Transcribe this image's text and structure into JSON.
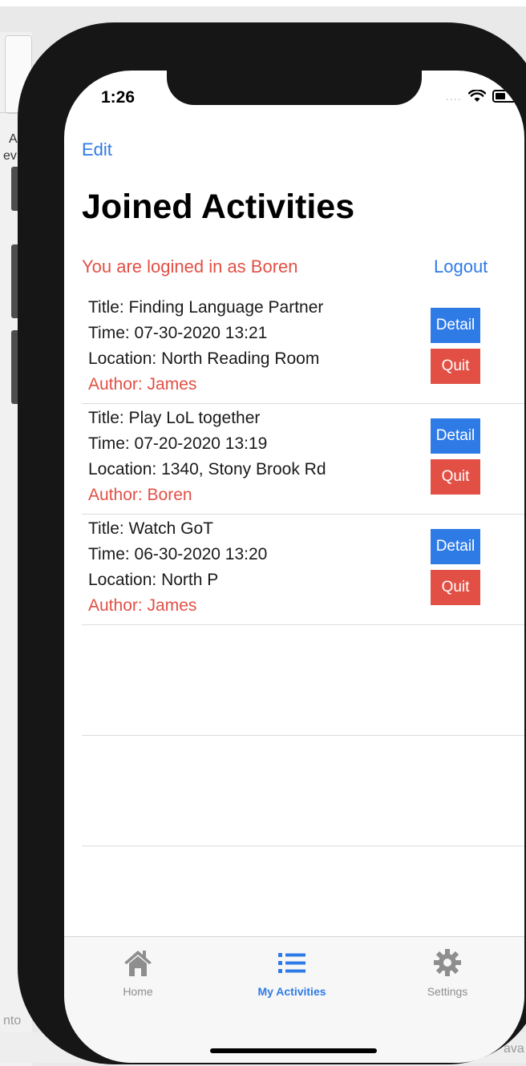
{
  "background": {
    "left_letters": [
      "A",
      "ev"
    ],
    "bottom_left_text": "nto",
    "bottom_right_text": "ava"
  },
  "status_bar": {
    "time": "1:26",
    "signal": "...."
  },
  "nav": {
    "edit_label": "Edit",
    "title": "Joined Activities"
  },
  "session": {
    "status_text": "You are logined in as Boren",
    "logout_label": "Logout"
  },
  "activities": [
    {
      "title": "Title: Finding Language Partner",
      "time": "Time: 07-30-2020 13:21",
      "location": "Location: North Reading Room",
      "author": "Author: James",
      "detail_label": "Detail",
      "quit_label": "Quit"
    },
    {
      "title": "Title: Play LoL together",
      "time": "Time: 07-20-2020 13:19",
      "location": "Location: 1340, Stony Brook Rd",
      "author": "Author: Boren",
      "detail_label": "Detail",
      "quit_label": "Quit"
    },
    {
      "title": "Title: Watch GoT",
      "time": "Time: 06-30-2020 13:20",
      "location": "Location: North P",
      "author": "Author: James",
      "detail_label": "Detail",
      "quit_label": "Quit"
    }
  ],
  "tab_bar": {
    "tabs": [
      {
        "label": "Home",
        "icon": "house-icon",
        "active": false
      },
      {
        "label": "My Activities",
        "icon": "list-icon",
        "active": true
      },
      {
        "label": "Settings",
        "icon": "gear-icon",
        "active": false
      }
    ]
  },
  "colors": {
    "accent_blue": "#2f7be6",
    "accent_red": "#e25045"
  }
}
